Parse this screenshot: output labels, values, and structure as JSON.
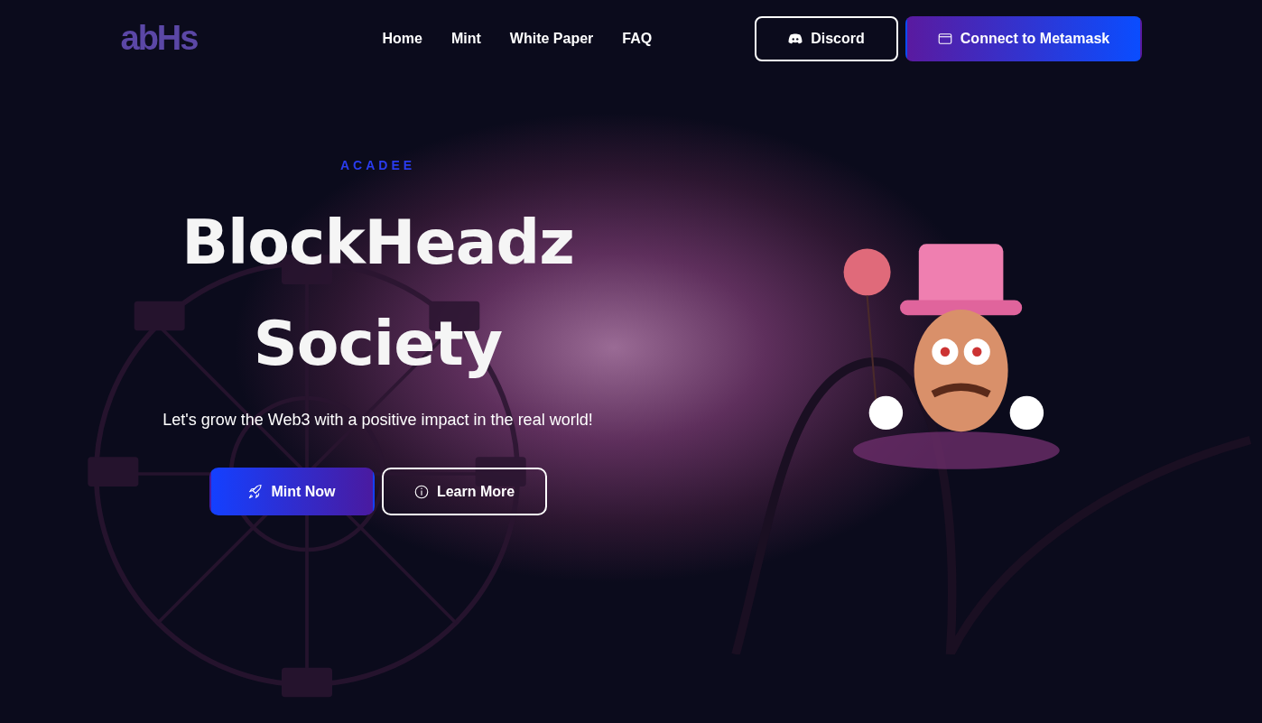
{
  "logo": "abHs",
  "nav": [
    {
      "label": "Home"
    },
    {
      "label": "Mint"
    },
    {
      "label": "White Paper"
    },
    {
      "label": "FAQ"
    }
  ],
  "header_buttons": [
    {
      "label": "Discord",
      "kind": "outline"
    },
    {
      "label": "Connect to Metamask",
      "kind": "gradient"
    }
  ],
  "hero": {
    "eyebrow": "ACADEE",
    "title_lines": [
      "BlockHeadz",
      "Society"
    ],
    "subtitle": "Let's grow the Web3 with a positive impact in the real world!",
    "buttons": [
      {
        "label": "Mint Now",
        "kind": "gradient"
      },
      {
        "label": "Learn More",
        "kind": "outline"
      }
    ]
  }
}
